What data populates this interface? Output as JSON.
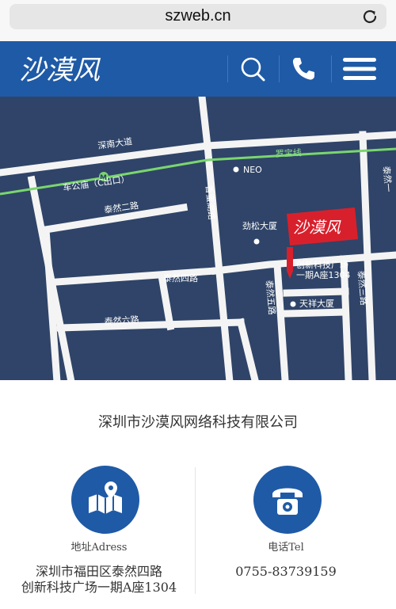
{
  "browser": {
    "url": "szweb.cn",
    "reload_icon": "reload-icon"
  },
  "header": {
    "logo_text": "沙漠风",
    "icons": [
      "search-icon",
      "phone-icon",
      "menu-icon"
    ]
  },
  "map": {
    "roads": {
      "shennan": "深南大道",
      "xiangmihu": "香蜜湖路",
      "tairan_er": "泰然二路",
      "tairan_si": "泰然四路",
      "tairan_liu": "泰然六路",
      "tairan_wu": "泰然五路",
      "tairan_san": "泰然三路",
      "tairan_yi": "泰然一"
    },
    "metro_line": "罗宝线",
    "metro_station": "车公庙（C出口）",
    "landmarks": {
      "neo": "NEO",
      "jinsong": "劲松大厦",
      "tianxiang": "天祥大厦"
    },
    "logo_sign": "沙漠风",
    "destination_line1": "创新科技广场",
    "destination_line2": "一期A座1304"
  },
  "company_name": "深圳市沙漠风网络科技有限公司",
  "contacts": [
    {
      "icon": "map-pin-icon",
      "label": "地址Adress",
      "value_line1": "深圳市福田区泰然四路",
      "value_line2": "创新科技广场一期A座1304"
    },
    {
      "icon": "telephone-icon",
      "label": "电话Tel",
      "value_line1": "0755-83739159"
    }
  ],
  "colors": {
    "brand_blue": "#1f5aa6",
    "map_bg": "#2f4468",
    "metro_green": "#7ad66e",
    "sign_red": "#d8202c"
  }
}
